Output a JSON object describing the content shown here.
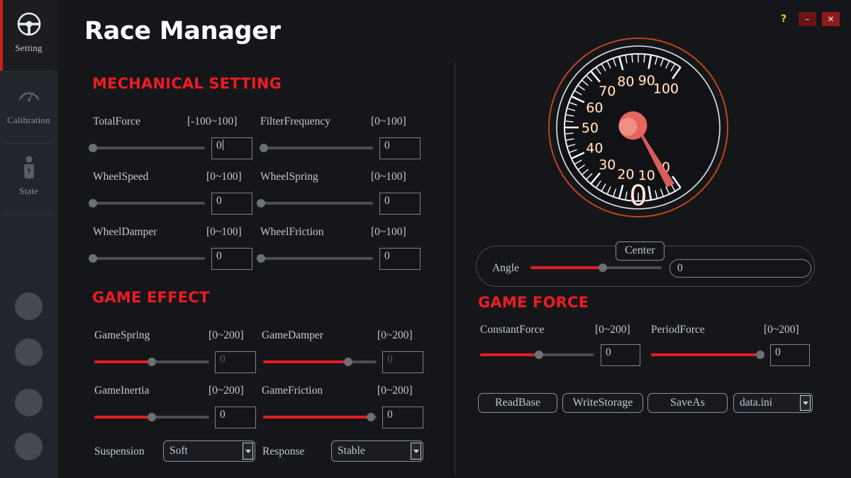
{
  "window": {
    "title": "Race Manager",
    "help_label": "?",
    "minimize_label": "–",
    "close_label": "✕",
    "accent_red": "#ec1c24",
    "background": "#151619"
  },
  "sidebar": {
    "items": [
      {
        "label": "Setting",
        "icon": "steering-wheel-icon",
        "active": true
      },
      {
        "label": "Calibration",
        "icon": "gauge-icon",
        "active": false
      },
      {
        "label": "State",
        "icon": "person-icon",
        "active": false
      }
    ],
    "lang_dots": [
      {
        "name": "globe-icon-1"
      },
      {
        "name": "globe-icon-2"
      },
      {
        "name": "globe-icon-3"
      },
      {
        "name": "globe-icon-4"
      }
    ]
  },
  "mechanical": {
    "title": "MECHANICAL SETTING",
    "params": [
      {
        "label": "TotalForce",
        "range": "[-100~100]",
        "value": "0",
        "fill_pct": 0,
        "knob_pct": 0,
        "caret": true,
        "dim": false
      },
      {
        "label": "FilterFrequency",
        "range": "[0~100]",
        "value": "0",
        "fill_pct": 1,
        "knob_pct": 0,
        "caret": false,
        "dim": false
      },
      {
        "label": "WheelSpeed",
        "range": "[0~100]",
        "value": "0",
        "fill_pct": 0,
        "knob_pct": 0,
        "caret": false,
        "dim": false
      },
      {
        "label": "WheelSpring",
        "range": "[0~100]",
        "value": "0",
        "fill_pct": 0,
        "knob_pct": 0,
        "caret": false,
        "dim": false
      },
      {
        "label": "WheelDamper",
        "range": "[0~100]",
        "value": "0",
        "fill_pct": 0,
        "knob_pct": 0,
        "caret": false,
        "dim": false
      },
      {
        "label": "WheelFriction",
        "range": "[0~100]",
        "value": "0",
        "fill_pct": 0,
        "knob_pct": 0,
        "caret": false,
        "dim": false
      }
    ]
  },
  "game_effect": {
    "title": "GAME EFFECT",
    "params": [
      {
        "label": "GameSpring",
        "range": "[0~200]",
        "value": "0",
        "fill_pct": 50,
        "knob_pct": 50,
        "caret": false,
        "dim": true
      },
      {
        "label": "GameDamper",
        "range": "[0~200]",
        "value": "0",
        "fill_pct": 75,
        "knob_pct": 75,
        "caret": false,
        "dim": true
      },
      {
        "label": "GameInertia",
        "range": "[0~200]",
        "value": "0",
        "fill_pct": 50,
        "knob_pct": 50,
        "caret": false,
        "dim": false
      },
      {
        "label": "GameFriction",
        "range": "[0~200]",
        "value": "0",
        "fill_pct": 95,
        "knob_pct": 95,
        "caret": false,
        "dim": false
      }
    ],
    "suspension_label": "Suspension",
    "suspension_value": "Soft",
    "response_label": "Response",
    "response_value": "Stable"
  },
  "gauge": {
    "min": 0,
    "max": 100,
    "value": 0,
    "ticks": [
      0,
      10,
      20,
      30,
      40,
      50,
      60,
      70,
      80,
      90,
      100
    ],
    "readout": "0",
    "needle_color": "#e8645e",
    "ring_color": "#c0441a"
  },
  "angle": {
    "center_label": "Center",
    "label": "Angle",
    "value": "0",
    "fill_pct": 50,
    "knob_pct": 50
  },
  "game_force": {
    "title": "GAME FORCE",
    "params": [
      {
        "label": "ConstantForce",
        "range": "[0~200]",
        "value": "0",
        "fill_pct": 52,
        "knob_pct": 52
      },
      {
        "label": "PeriodForce",
        "range": "[0~200]",
        "value": "0",
        "fill_pct": 96,
        "knob_pct": 96
      }
    ]
  },
  "actions": {
    "read_base": "ReadBase",
    "write_storage": "WriteStorage",
    "save_as": "SaveAs",
    "file_value": "data.ini"
  }
}
